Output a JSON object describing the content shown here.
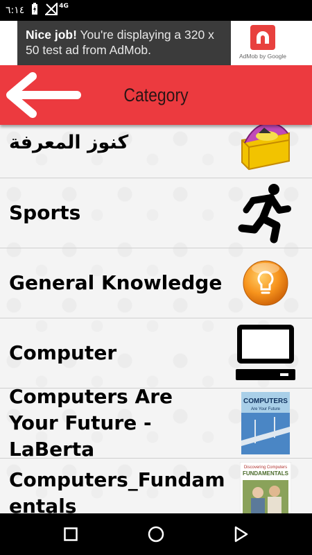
{
  "status_bar": {
    "time": "٦:١٤",
    "network": "4G"
  },
  "ad": {
    "highlight": "Nice job!",
    "message": " You're displaying a 320 x 50 test ad from AdMob.",
    "logo_caption": "AdMob by Google"
  },
  "header": {
    "title": "Category",
    "back_icon": "arrow-left-icon"
  },
  "categories": [
    {
      "label": "كنوز المعرفة",
      "icon": "treasure-icon"
    },
    {
      "label": "Sports",
      "icon": "runner-icon"
    },
    {
      "label": "General Knowledge",
      "icon": "lightbulb-icon"
    },
    {
      "label": "Computer",
      "icon": "computer-icon"
    },
    {
      "label": "Computers Are Your Future - LaBerta",
      "icon": "book-cover-icon",
      "cover_title": "COMPUTERS",
      "cover_subtitle": "Are Your Future"
    },
    {
      "label": "Computers_Fundamentals",
      "icon": "book-cover-icon",
      "cover_title": "FUNDAMENTALS",
      "cover_subtitle": "Discovering Computers"
    }
  ],
  "colors": {
    "header": "#ec3a3f",
    "ad_background": "#3b3b3b"
  }
}
